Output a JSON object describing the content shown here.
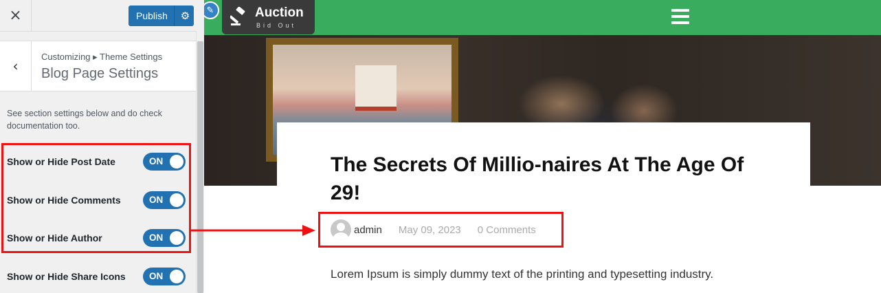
{
  "customizer": {
    "close_icon": "×",
    "publish_label": "Publish",
    "gear_icon": "⚙",
    "breadcrumb": "Customizing ▸ Theme Settings",
    "section_title": "Blog Page Settings",
    "back_icon": "‹",
    "description": "See section settings below and do check documentation too.",
    "controls": [
      {
        "label": "Show or Hide Post Date",
        "state": "ON"
      },
      {
        "label": "Show or Hide Comments",
        "state": "ON"
      },
      {
        "label": "Show or Hide Author",
        "state": "ON"
      },
      {
        "label": "Show or Hide Share Icons",
        "state": "ON"
      }
    ]
  },
  "preview": {
    "edit_icon": "✎",
    "logo_icon": "gavel-icon",
    "logo_name": "Auction",
    "logo_tagline": "Bid Out",
    "post_title": "The Secrets Of Millio-naires At The Age Of 29!",
    "meta": {
      "author": "admin",
      "date": "May 09, 2023",
      "comments": "0 Comments"
    },
    "excerpt": "Lorem Ipsum is simply dummy text of the printing and typesetting industry."
  },
  "colors": {
    "header_green": "#3aac5d",
    "toggle_blue": "#2271b1",
    "highlight_red": "#ee1111"
  }
}
